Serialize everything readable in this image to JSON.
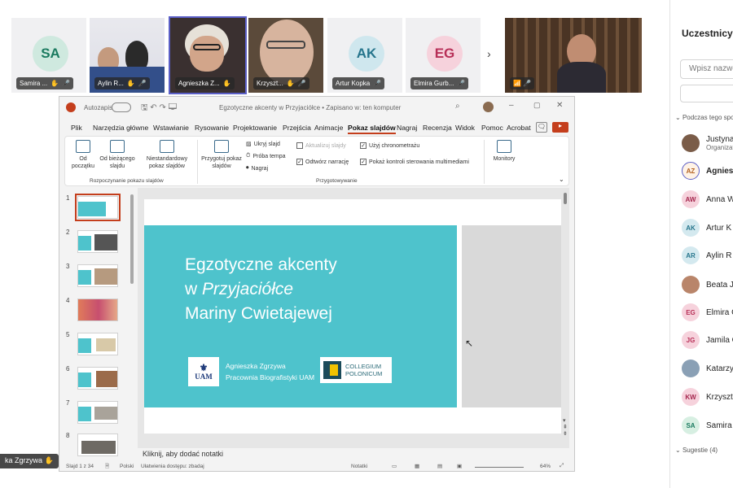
{
  "strip": {
    "tiles": [
      {
        "initials": "SA",
        "name": "Samira ...",
        "color": "#1a7a5f",
        "bg": "#cfe9df"
      },
      {
        "name": "Aylin R..."
      },
      {
        "name": "Agnieszka Z..."
      },
      {
        "name": "Krzyszt..."
      },
      {
        "initials": "AK",
        "name": "Artur Kopka",
        "color": "#26758c",
        "bg": "#cfe7ee"
      },
      {
        "initials": "EG",
        "name": "Elmira Gurb...",
        "color": "#b72f57",
        "bg": "#f6d2dc"
      }
    ],
    "next_icon": "›",
    "self_icons": "📶 🎤"
  },
  "panel": {
    "title": "Uczestnicy",
    "search_placeholder": "Wpisz nazwę",
    "section_during": "Podczas tego spotkania",
    "participants": [
      {
        "initials": "",
        "name": "Justyna",
        "sub": "Organizator",
        "bg": "#7a5c48",
        "color": "#fff"
      },
      {
        "initials": "AZ",
        "name": "Agnieszka",
        "bg": "#fff3e6",
        "color": "#b26020"
      },
      {
        "initials": "AW",
        "name": "Anna W",
        "bg": "#f6d2dc",
        "color": "#a4264d"
      },
      {
        "initials": "AK",
        "name": "Artur K",
        "bg": "#d4e9ef",
        "color": "#26758c"
      },
      {
        "initials": "AR",
        "name": "Aylin R",
        "bg": "#d4e9ef",
        "color": "#26758c"
      },
      {
        "initials": "",
        "name": "Beata J",
        "bg": "#b9856a",
        "color": "#fff"
      },
      {
        "initials": "EG",
        "name": "Elmira G",
        "bg": "#f6d2dc",
        "color": "#b72f57"
      },
      {
        "initials": "JG",
        "name": "Jamila G",
        "bg": "#f6d2dc",
        "color": "#b72f57"
      },
      {
        "initials": "",
        "name": "Katarzyna",
        "bg": "#8aa0b5",
        "color": "#fff"
      },
      {
        "initials": "KW",
        "name": "Krzysztof",
        "bg": "#f6d2dc",
        "color": "#a4264d"
      },
      {
        "initials": "SA",
        "name": "Samira",
        "bg": "#d7efe2",
        "color": "#1a7a5f"
      }
    ],
    "section_suggestions": "Sugestie (4)"
  },
  "ppt": {
    "autosave_label": "Autozapis",
    "doc_title": "Egzotyczne akcenty w Przyjaciółce • Zapisano w: ten komputer",
    "menu": [
      "Plik",
      "Narzędzia główne",
      "Wstawianie",
      "Rysowanie",
      "Projektowanie",
      "Przejścia",
      "Animacje",
      "Pokaz slajdów",
      "Nagraj",
      "Recenzja",
      "Widok",
      "Pomoc",
      "Acrobat"
    ],
    "active_menu": "Pokaz slajdów",
    "ribbon": {
      "from_start": "Od początku",
      "from_current": "Od bieżącego slajdu",
      "custom": "Niestandardowy pokaz slajdów",
      "setup": "Przygotuj pokaz slajdów",
      "hide": "Ukryj slajd",
      "rehearse": "Próba tempa",
      "record": "Nagraj",
      "update_slides": "Aktualizuj slajdy",
      "play_narr": "Odtwórz narrację",
      "use_timings": "Użyj chronometrażu",
      "show_controls": "Pokaż kontroli sterowania multimediami",
      "monitors": "Monitory",
      "group_start": "Rozpoczynanie pokazu slajdów",
      "group_setup": "Przygotowywanie"
    },
    "thumb_numbers": [
      "1",
      "2",
      "3",
      "4",
      "5",
      "6",
      "7",
      "8"
    ],
    "notes_placeholder": "Kliknij, aby dodać notatki",
    "status_left": "Slajd 1 z 34",
    "status_lang": "Polski",
    "status_access": "Ułatwienia dostępu: zbadaj",
    "status_notes": "Notatki",
    "zoom": "64%"
  },
  "slide": {
    "title_line1": "Egzotyczne akcenty",
    "title_line2_pre": "w ",
    "title_line2_em": "Przyjaciółce",
    "title_line3": "Mariny Cwietajewej",
    "author": "Agnieszka Zgrzywa",
    "affiliation": "Pracownia Biografistyki UAM",
    "logo_uam": "UAM",
    "colleg_1": "COLLEGIUM",
    "colleg_2": "POLONICUM"
  },
  "presenter_label": "ka Zgrzywa"
}
